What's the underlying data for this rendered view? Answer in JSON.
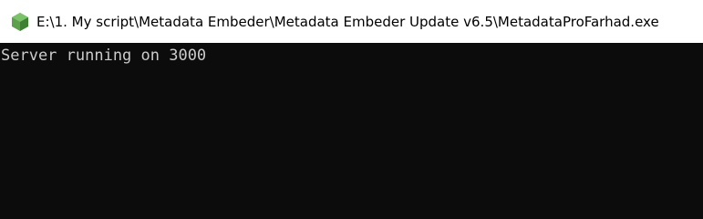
{
  "window": {
    "title": "E:\\1. My script\\Metadata Embeder\\Metadata Embeder Update v6.5\\MetadataProFarhad.exe",
    "icon": "nodejs-hexagon-icon"
  },
  "console": {
    "lines": [
      "Server running on 3000"
    ]
  },
  "colors": {
    "titlebar_bg": "#ffffff",
    "console_bg": "#0c0c0c",
    "console_text": "#cccccc",
    "icon_green": "#5fa04e"
  }
}
